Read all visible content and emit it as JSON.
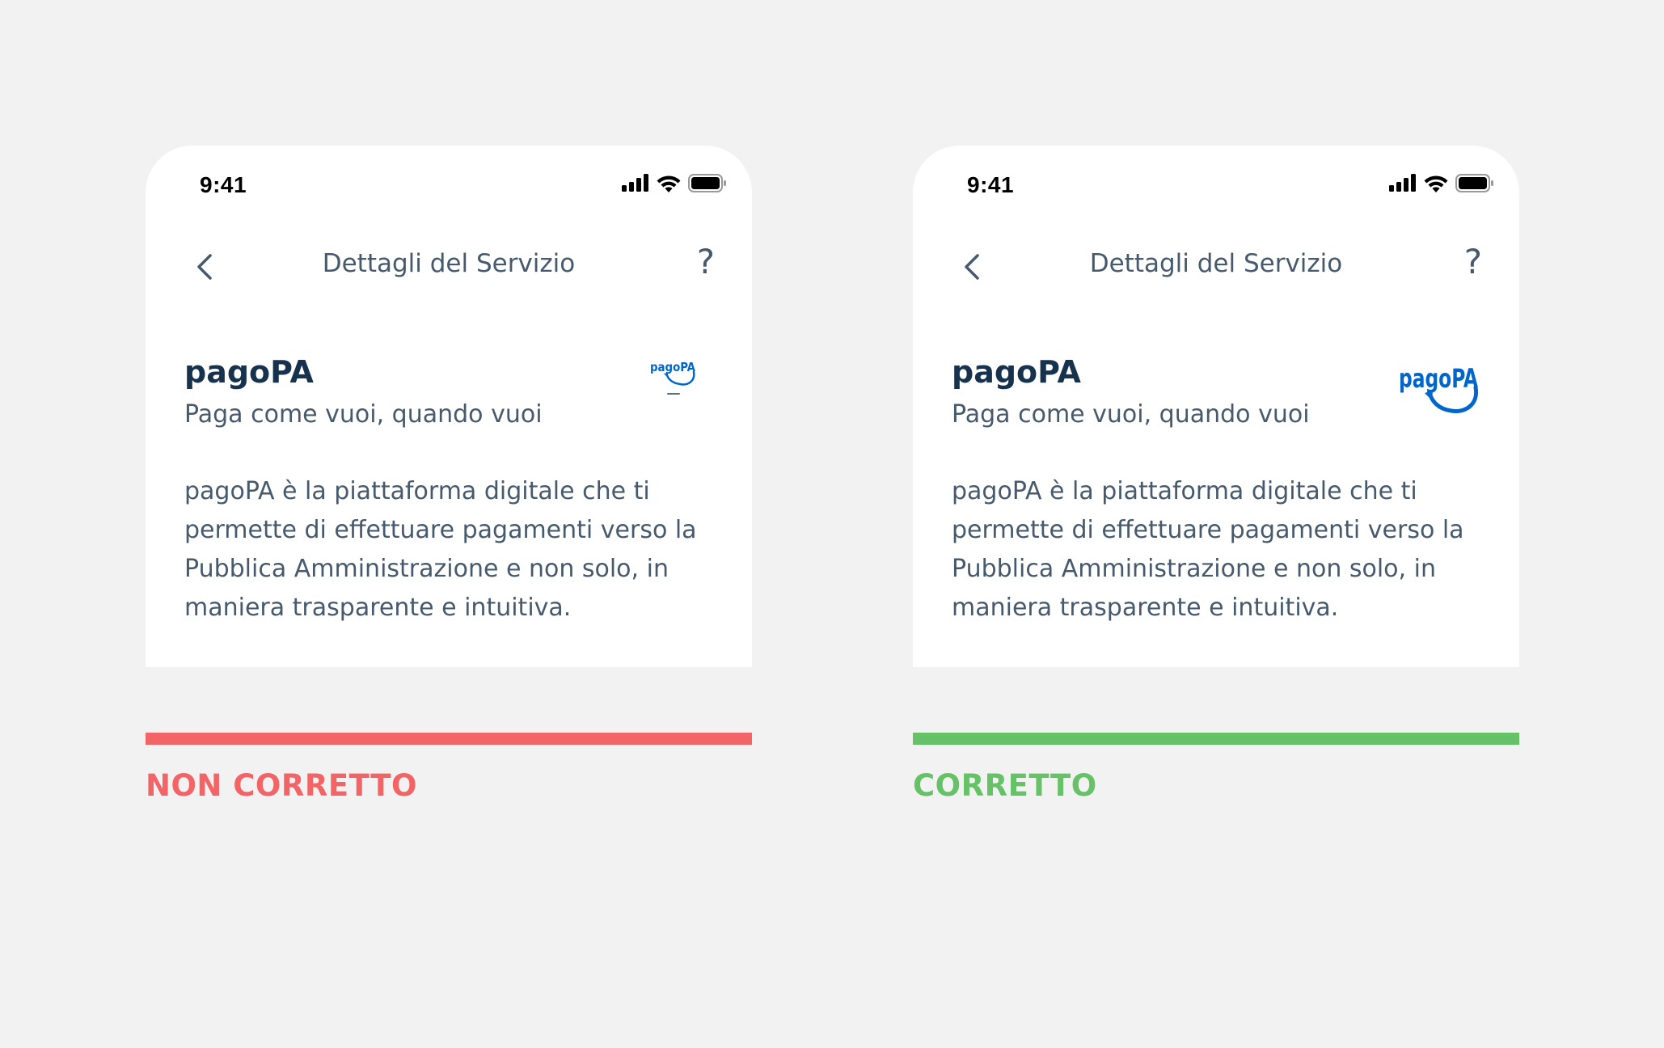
{
  "colors": {
    "page_bg": "#f2f2f2",
    "card_bg": "#ffffff",
    "text_primary": "#17324d",
    "text_secondary": "#475a6d",
    "logo_blue": "#0066cc",
    "incorrect": "#f36466",
    "correct": "#66c266"
  },
  "panels": [
    {
      "status_time": "9:41",
      "nav_title": "Dettagli del Servizio",
      "help_label": "?",
      "service_name": "pagoPA",
      "service_subtitle": "Paga come vuoi, quando vuoi",
      "service_description": "pagoPA è la piattaforma digitale che ti permette di effettuare pagamenti verso la Pubblica Amministrazione e non solo, in maniera trasparente e intuitiva.",
      "logo_text": "pagoPA",
      "logo_variant": "small-with-wordmark",
      "verdict_label": "NON CORRETTO"
    },
    {
      "status_time": "9:41",
      "nav_title": "Dettagli del Servizio",
      "help_label": "?",
      "service_name": "pagoPA",
      "service_subtitle": "Paga come vuoi, quando vuoi",
      "service_description": "pagoPA è la piattaforma digitale che ti permette di effettuare pagamenti verso la Pubblica Amministrazione e non solo, in maniera trasparente e intuitiva.",
      "logo_text": "pagoPA",
      "logo_variant": "large",
      "verdict_label": "CORRETTO"
    }
  ],
  "icons": {
    "back": "chevron-left-icon",
    "help": "question-mark-icon",
    "signal": "cellular-signal-icon",
    "wifi": "wifi-icon",
    "battery": "battery-icon"
  }
}
